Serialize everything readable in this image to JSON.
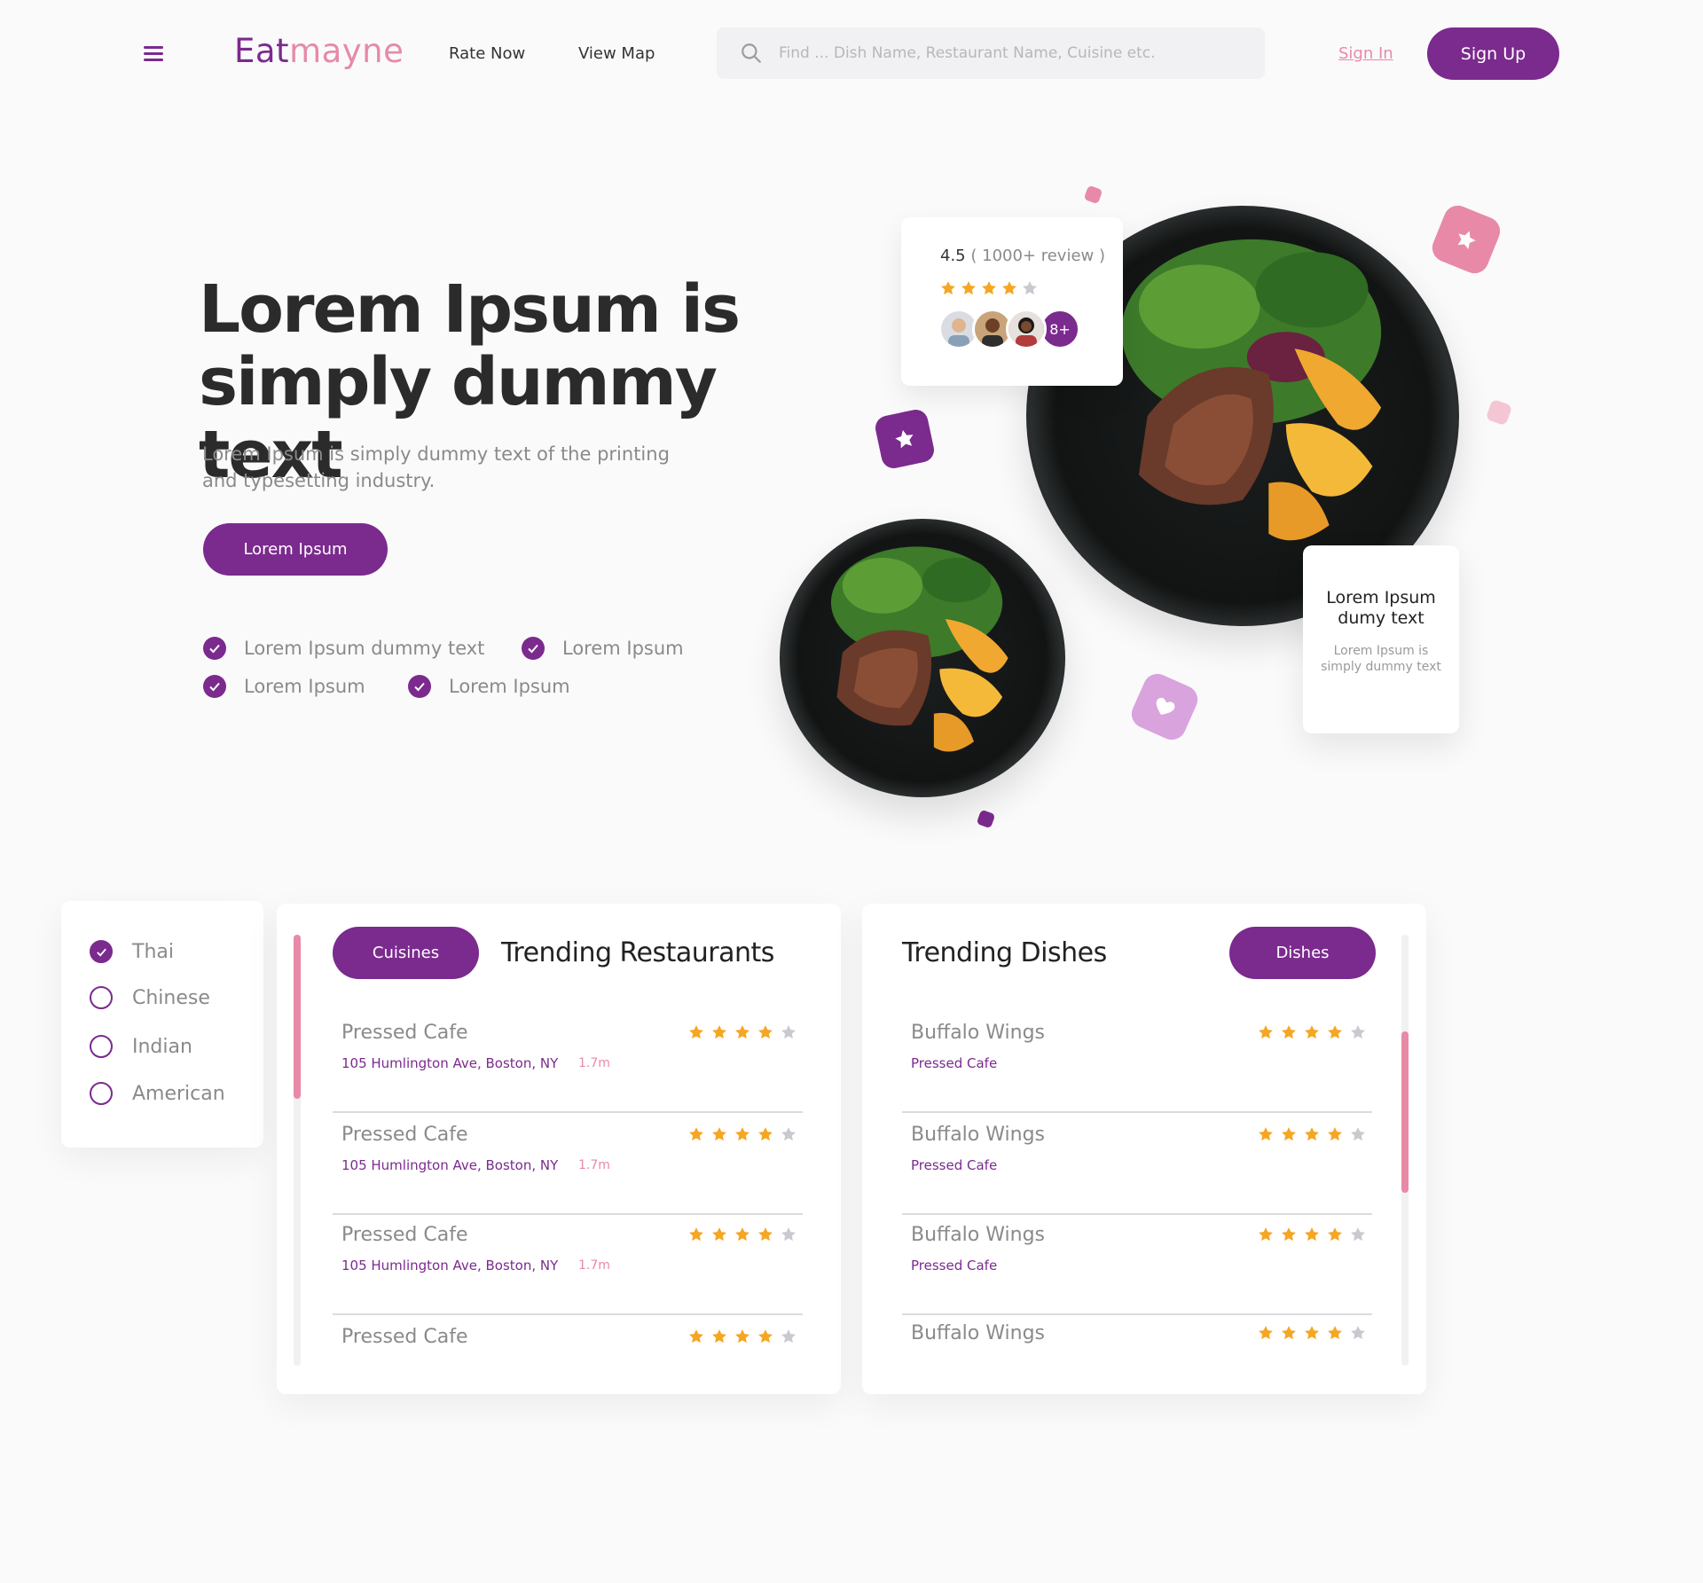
{
  "header": {
    "logo_a": "Eat",
    "logo_b": "mayne",
    "nav": [
      "Rate Now",
      "View Map"
    ],
    "search_placeholder": "Find ... Dish Name, Restaurant Name, Cuisine etc.",
    "signin_label": "Sign In",
    "signup_label": "Sign Up"
  },
  "hero": {
    "title_line1": "Lorem Ipsum is",
    "title_line2": "simply dummy text",
    "subtitle": "Lorem Ipsum is simply dummy text of the printing and typesetting industry.",
    "cta_label": "Lorem Ipsum",
    "features": [
      "Lorem Ipsum dummy text",
      "Lorem Ipsum",
      "Lorem Ipsum",
      "Lorem Ipsum"
    ]
  },
  "rating_card": {
    "score": "4.5",
    "reviews": "( 1000+ review )",
    "stars": 4,
    "more_label": "8+"
  },
  "info_card": {
    "title": "Lorem Ipsum dumy text",
    "subtitle": "Lorem Ipsum is simply dummy text"
  },
  "filters": {
    "options": [
      {
        "label": "Thai",
        "checked": true
      },
      {
        "label": "Chinese",
        "checked": false
      },
      {
        "label": "Indian",
        "checked": false
      },
      {
        "label": "American",
        "checked": false
      }
    ]
  },
  "restaurants": {
    "pill_label": "Cuisines",
    "title": "Trending Restaurants",
    "items": [
      {
        "name": "Pressed Cafe",
        "address": "105 Humlington Ave, Boston, NY",
        "distance": "1.7m",
        "stars": 4
      },
      {
        "name": "Pressed Cafe",
        "address": "105 Humlington Ave, Boston, NY",
        "distance": "1.7m",
        "stars": 4
      },
      {
        "name": "Pressed Cafe",
        "address": "105 Humlington Ave, Boston, NY",
        "distance": "1.7m",
        "stars": 4
      },
      {
        "name": "Pressed Cafe",
        "address": "",
        "distance": "",
        "stars": 4
      }
    ]
  },
  "dishes": {
    "pill_label": "Dishes",
    "title": "Trending Dishes",
    "items": [
      {
        "name": "Buffalo Wings",
        "place": "Pressed Cafe",
        "stars": 4
      },
      {
        "name": "Buffalo Wings",
        "place": "Pressed Cafe",
        "stars": 4
      },
      {
        "name": "Buffalo Wings",
        "place": "Pressed Cafe",
        "stars": 4
      },
      {
        "name": "Buffalo Wings",
        "place": "",
        "stars": 4
      }
    ]
  },
  "colors": {
    "brand": "#7b2a8e",
    "accent_pink": "#e88aa7",
    "star": "#f5a623",
    "star_empty": "#c9c9cf"
  }
}
